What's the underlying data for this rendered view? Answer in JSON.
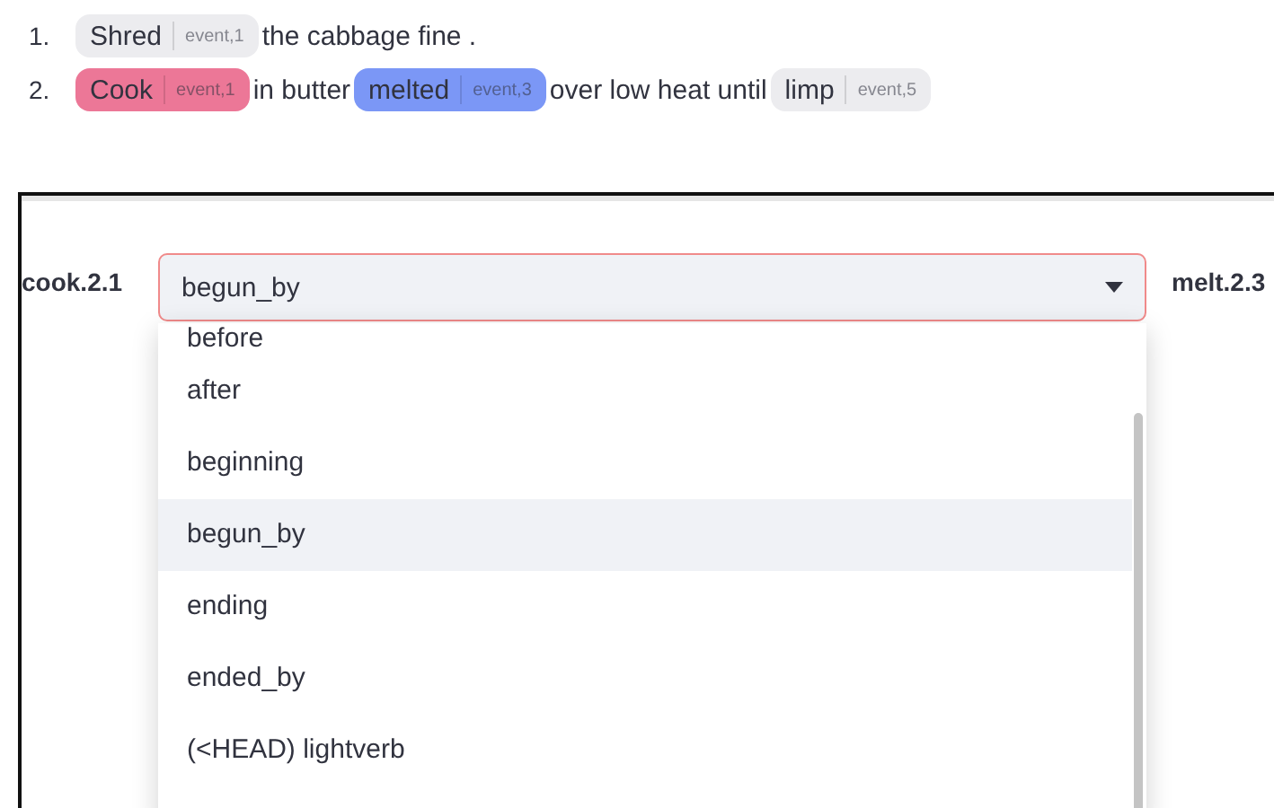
{
  "sentences": [
    {
      "number": "1.",
      "parts": [
        {
          "kind": "chip",
          "label": "Shred",
          "tag": "event,1",
          "color": "#ececef"
        },
        {
          "kind": "text",
          "text": "the cabbage fine ."
        }
      ]
    },
    {
      "number": "2.",
      "parts": [
        {
          "kind": "chip",
          "label": "Cook",
          "tag": "event,1",
          "color": "#ec7797"
        },
        {
          "kind": "text",
          "text": "in butter"
        },
        {
          "kind": "chip",
          "label": "melted",
          "tag": "event,3",
          "color": "#7b97f6"
        },
        {
          "kind": "text",
          "text": "over low heat until"
        },
        {
          "kind": "chip",
          "label": "limp",
          "tag": "event,5",
          "color": "#ececef"
        }
      ]
    }
  ],
  "relation": {
    "left": "cook.2.1",
    "right": "melt.2.3",
    "select": {
      "value": "begun_by",
      "expanded": true
    },
    "options": [
      {
        "label": "before",
        "selected": false
      },
      {
        "label": "after",
        "selected": false
      },
      {
        "label": "beginning",
        "selected": false
      },
      {
        "label": "begun_by",
        "selected": true
      },
      {
        "label": "ending",
        "selected": false
      },
      {
        "label": "ended_by",
        "selected": false
      },
      {
        "label": "(<HEAD) lightverb",
        "selected": false
      }
    ]
  }
}
